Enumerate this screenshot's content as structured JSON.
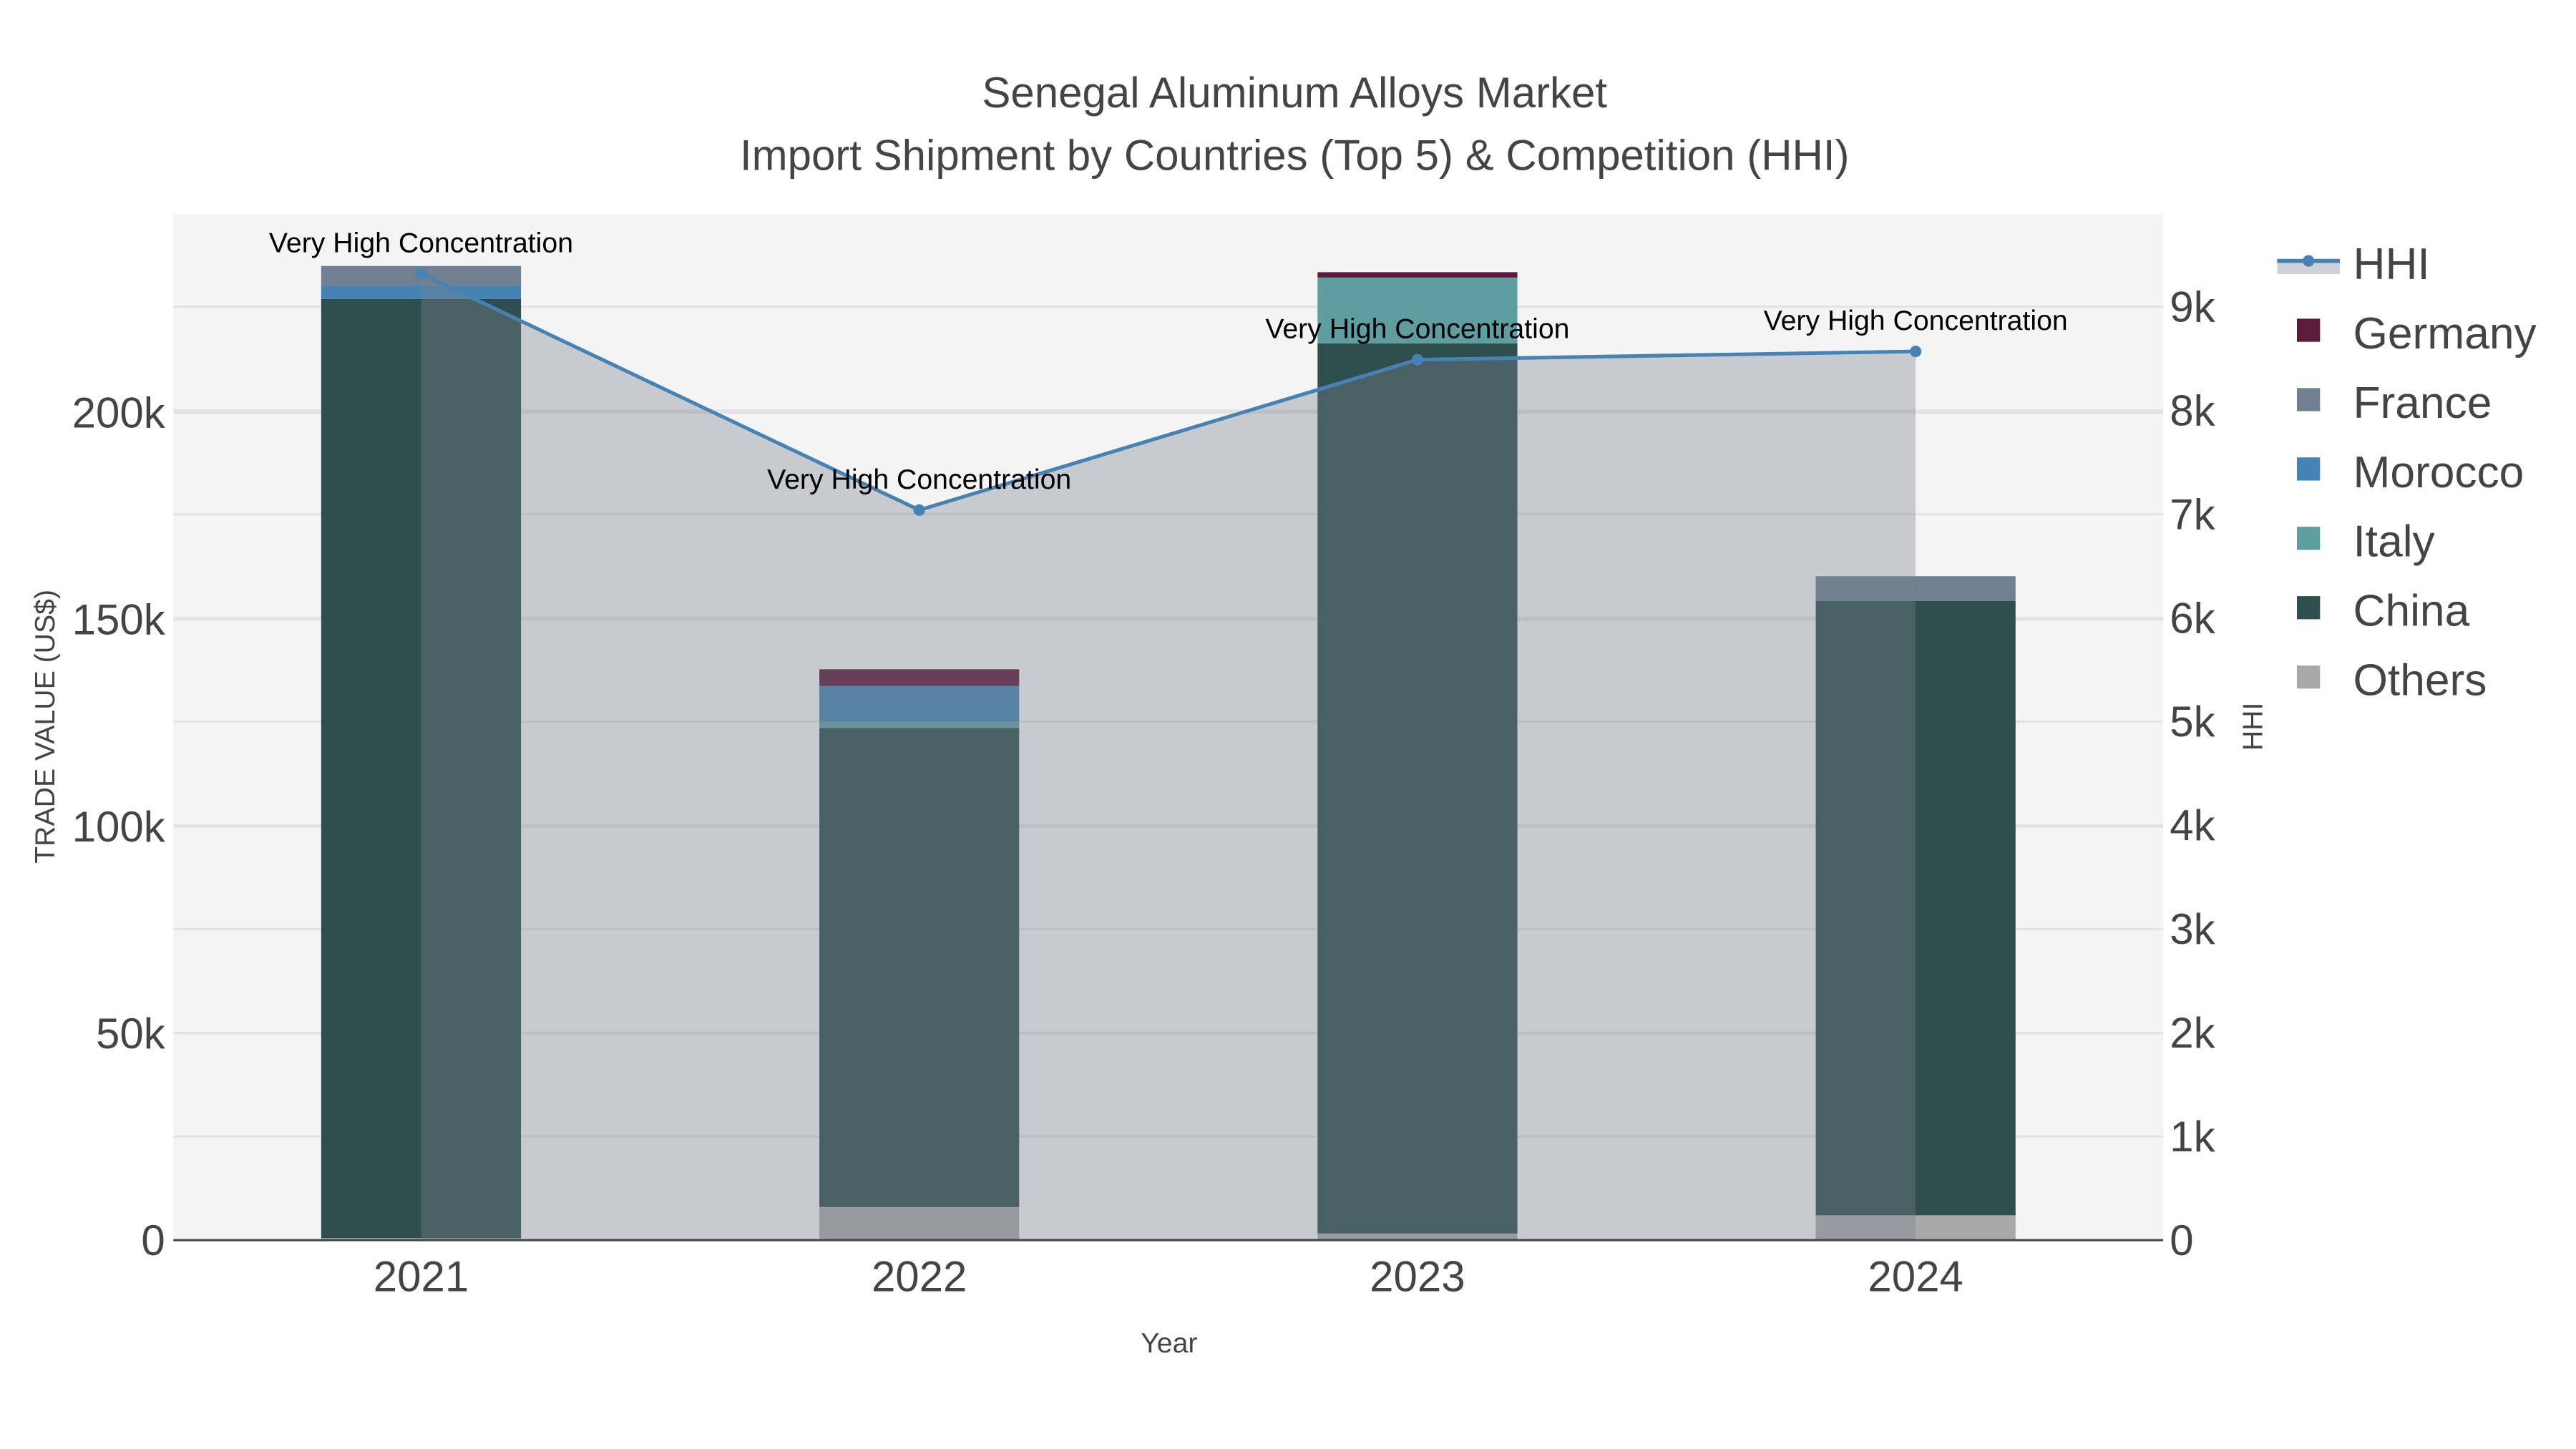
{
  "chart_data": {
    "type": "bar",
    "barmode": "stack",
    "title": "Senegal Aluminum Alloys Market",
    "subtitle": "Import Shipment by Countries (Top 5) & Competition (HHI)",
    "xlabel": "Year",
    "ylabel": "TRADE VALUE (US$)",
    "y2label": "HHI",
    "categories": [
      "2021",
      "2022",
      "2023",
      "2024"
    ],
    "ylim": [
      0,
      247000
    ],
    "y2lim": [
      0,
      9900
    ],
    "yticks": [
      0,
      50000,
      100000,
      150000,
      200000
    ],
    "ytick_labels": [
      "0",
      "50k",
      "100k",
      "150k",
      "200k"
    ],
    "y2ticks": [
      0,
      1000,
      2000,
      3000,
      4000,
      5000,
      6000,
      7000,
      8000,
      9000
    ],
    "y2tick_labels": [
      "0",
      "1k",
      "2k",
      "3k",
      "4k",
      "5k",
      "6k",
      "7k",
      "8k",
      "9k"
    ],
    "grid": true,
    "legend_position": "right",
    "series": [
      {
        "name": "Others",
        "color": "#A9A9A9",
        "values": [
          500,
          8000,
          1600,
          6000
        ]
      },
      {
        "name": "China",
        "color": "#2F4F4F",
        "values": [
          227000,
          115800,
          215200,
          148500
        ]
      },
      {
        "name": "Italy",
        "color": "#5F9EA0",
        "values": [
          0,
          1500,
          15900,
          0
        ]
      },
      {
        "name": "Morocco",
        "color": "#4682B4",
        "values": [
          3200,
          8700,
          0,
          0
        ]
      },
      {
        "name": "France",
        "color": "#708090",
        "values": [
          4800,
          0,
          0,
          6000
        ]
      },
      {
        "name": "Germany",
        "color": "#5C1B3B",
        "values": [
          0,
          4000,
          1300,
          0
        ]
      }
    ],
    "hhi": {
      "name": "HHI",
      "color": "#4682B4",
      "values": [
        9320,
        7040,
        8490,
        8570
      ],
      "annotations": [
        "Very High Concentration",
        "Very High Concentration",
        "Very High Concentration",
        "Very High Concentration"
      ]
    },
    "legend": [
      "HHI",
      "Germany",
      "France",
      "Morocco",
      "Italy",
      "China",
      "Others"
    ]
  }
}
